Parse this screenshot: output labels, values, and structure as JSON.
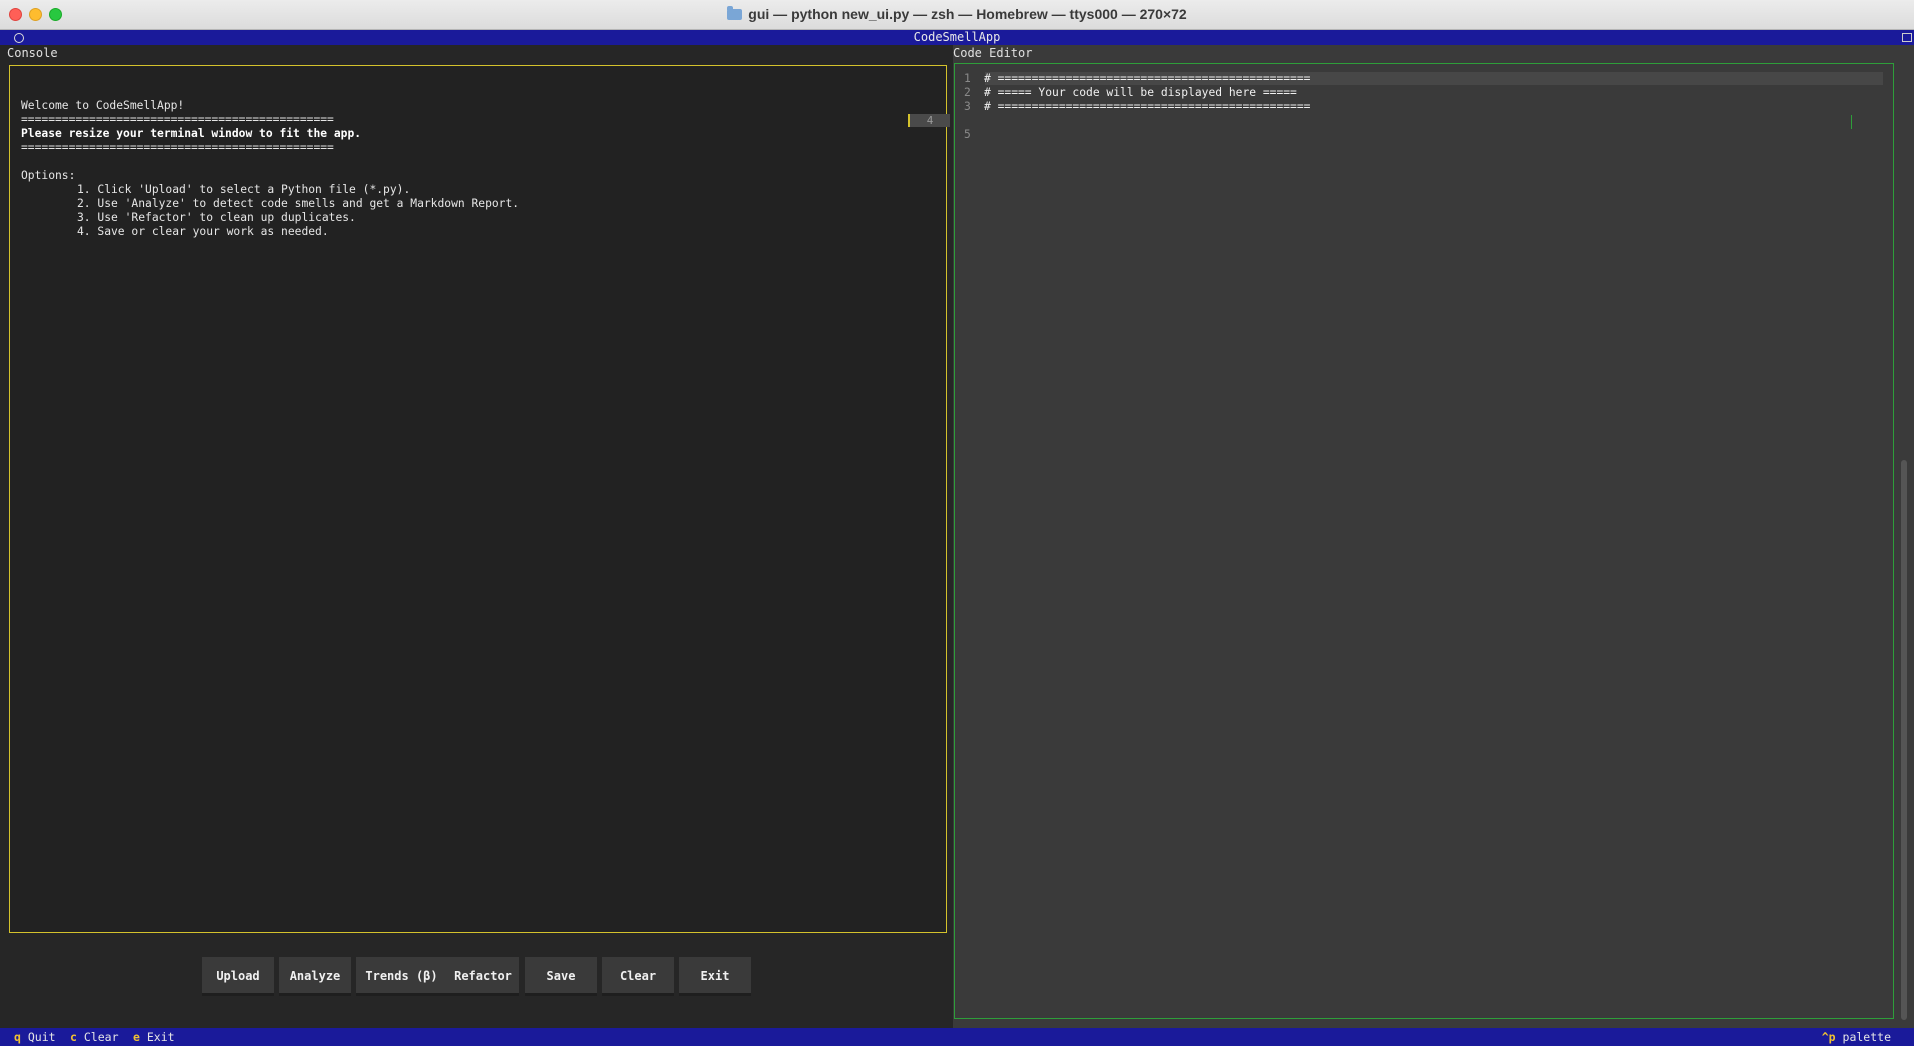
{
  "window": {
    "title": "gui — python new_ui.py — zsh — Homebrew — ttys000 — 270×72"
  },
  "app": {
    "title": "CodeSmellApp"
  },
  "console": {
    "label": "Console",
    "lines": {
      "welcome": "Welcome to CodeSmellApp!",
      "sep1": "==============================================",
      "resize": "Please resize your terminal window to fit the app.",
      "sep2": "==============================================",
      "options": "Options:",
      "opt1": "1. Click 'Upload' to select a Python file (*.py).",
      "opt2": "2. Use 'Analyze' to detect code smells and get a Markdown Report.",
      "opt3": "3. Use 'Refactor' to clean up duplicates.",
      "opt4": "4. Save or clear your work as needed."
    }
  },
  "editor": {
    "label": "Code Editor",
    "lines": [
      {
        "n": "1",
        "text": "# =============================================="
      },
      {
        "n": "2",
        "text": "# ===== Your code will be displayed here ====="
      },
      {
        "n": "3",
        "text": "# =============================================="
      },
      {
        "n": "5",
        "text": ""
      }
    ],
    "floating_line_number": "4"
  },
  "buttons": {
    "upload": "Upload",
    "analyze": "Analyze",
    "trends": "Trends (β)",
    "refactor": "Refactor",
    "save": "Save",
    "clear": "Clear",
    "exit": "Exit"
  },
  "footer": {
    "quit_key": "q",
    "quit_label": "Quit",
    "clear_key": "c",
    "clear_label": "Clear",
    "exit_key": "e",
    "exit_label": "Exit",
    "palette_key": "^p",
    "palette_label": "palette"
  },
  "colors": {
    "header_bg": "#1a1a9a",
    "console_border": "#d4c22c",
    "editor_border": "#2e9e3a",
    "key_accent": "#f1c232"
  }
}
